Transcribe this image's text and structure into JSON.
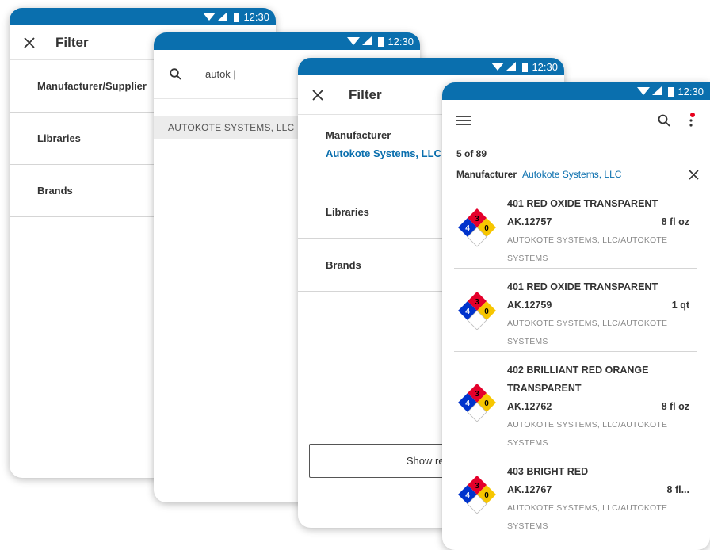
{
  "status_bar": {
    "time": "12:30"
  },
  "screen1": {
    "title": "Filter",
    "rows": [
      "Manufacturer/Supplier",
      "Libraries",
      "Brands"
    ]
  },
  "screen2": {
    "search_value": "autok |",
    "result": "AUTOKOTE SYSTEMS, LLC"
  },
  "screen3": {
    "title": "Filter",
    "manufacturer_label": "Manufacturer",
    "manufacturer_value": "Autokote Systems, LLC",
    "rows": [
      "Libraries",
      "Brands"
    ],
    "show_results_label": "Show res"
  },
  "screen4": {
    "count": "5 of 89",
    "filter_label": "Manufacturer",
    "filter_value": "Autokote Systems, LLC",
    "items": [
      {
        "name": "401 RED OXIDE TRANSPARENT",
        "sku": "AK.12757",
        "size": "8 fl oz",
        "mfr": "AUTOKOTE SYSTEMS, LLC/AUTOKOTE SYSTEMS",
        "nfpa": {
          "health": "4",
          "flammability": "3",
          "instability": "0"
        }
      },
      {
        "name": "401 RED OXIDE TRANSPARENT",
        "sku": "AK.12759",
        "size": "1 qt",
        "mfr": "AUTOKOTE SYSTEMS, LLC/AUTOKOTE SYSTEMS",
        "nfpa": {
          "health": "4",
          "flammability": "3",
          "instability": "0"
        }
      },
      {
        "name": "402 BRILLIANT RED ORANGE TRANSPARENT",
        "sku": "AK.12762",
        "size": "8 fl oz",
        "mfr": "AUTOKOTE SYSTEMS, LLC/AUTOKOTE SYSTEMS",
        "nfpa": {
          "health": "4",
          "flammability": "3",
          "instability": "0"
        }
      },
      {
        "name": "403 BRIGHT RED",
        "sku": "AK.12767",
        "size": "8 fl...",
        "mfr": "AUTOKOTE SYSTEMS, LLC/AUTOKOTE SYSTEMS",
        "nfpa": {
          "health": "4",
          "flammability": "3",
          "instability": "0"
        }
      }
    ]
  },
  "colors": {
    "accent": "#0a6fae",
    "nfpa_red": "#e4002b",
    "nfpa_blue": "#0033cc",
    "nfpa_yellow": "#f7c600",
    "notification_dot": "#e8001c"
  },
  "icons": [
    "wifi-icon",
    "signal-icon",
    "battery-icon",
    "close-icon",
    "search-icon",
    "menu-icon",
    "more-vert-icon",
    "nfpa-diamond-icon"
  ]
}
